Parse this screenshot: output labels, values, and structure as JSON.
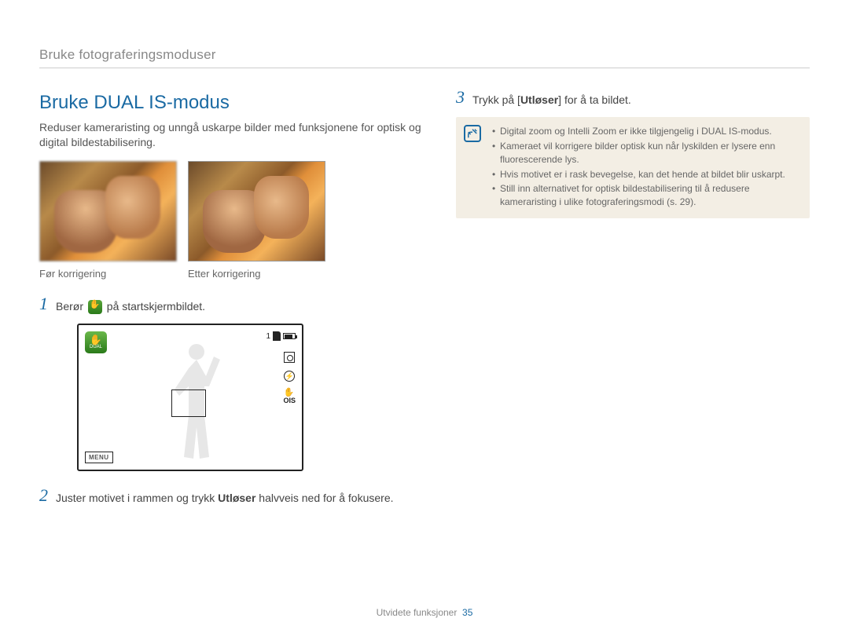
{
  "breadcrumb": "Bruke fotograferingsmoduser",
  "title": "Bruke DUAL IS-modus",
  "intro": "Reduser kameraristing og unngå uskarpe bilder med funksjonene for optisk og digital bildestabilisering.",
  "captions": {
    "before": "Før korrigering",
    "after": "Etter korrigering"
  },
  "steps": {
    "s1": {
      "num": "1",
      "pre": "Berør",
      "post": "på startskjermbildet."
    },
    "s2": {
      "num": "2",
      "pre": "Juster motivet i rammen og trykk ",
      "bold": "Utløser",
      "mid": " halvveis ned for å fokusere."
    },
    "s3": {
      "num": "3",
      "pre": "Trykk på [",
      "bold": "Utløser",
      "post": "] for å ta bildet."
    }
  },
  "screen": {
    "dual_label": "DUAL",
    "shots": "1",
    "menu": "MENU",
    "ois": "OIS"
  },
  "note": {
    "items": [
      "Digital zoom og Intelli Zoom er ikke tilgjengelig i DUAL IS-modus.",
      "Kameraet vil korrigere bilder optisk kun når lyskilden er lysere enn fluorescerende lys.",
      "Hvis motivet er i rask bevegelse, kan det hende at bildet blir uskarpt.",
      "Still inn alternativet for optisk bildestabilisering til å redusere kameraristing i ulike fotograferingsmodi (s. 29)."
    ]
  },
  "footer": {
    "section": "Utvidete funksjoner",
    "page": "35"
  }
}
